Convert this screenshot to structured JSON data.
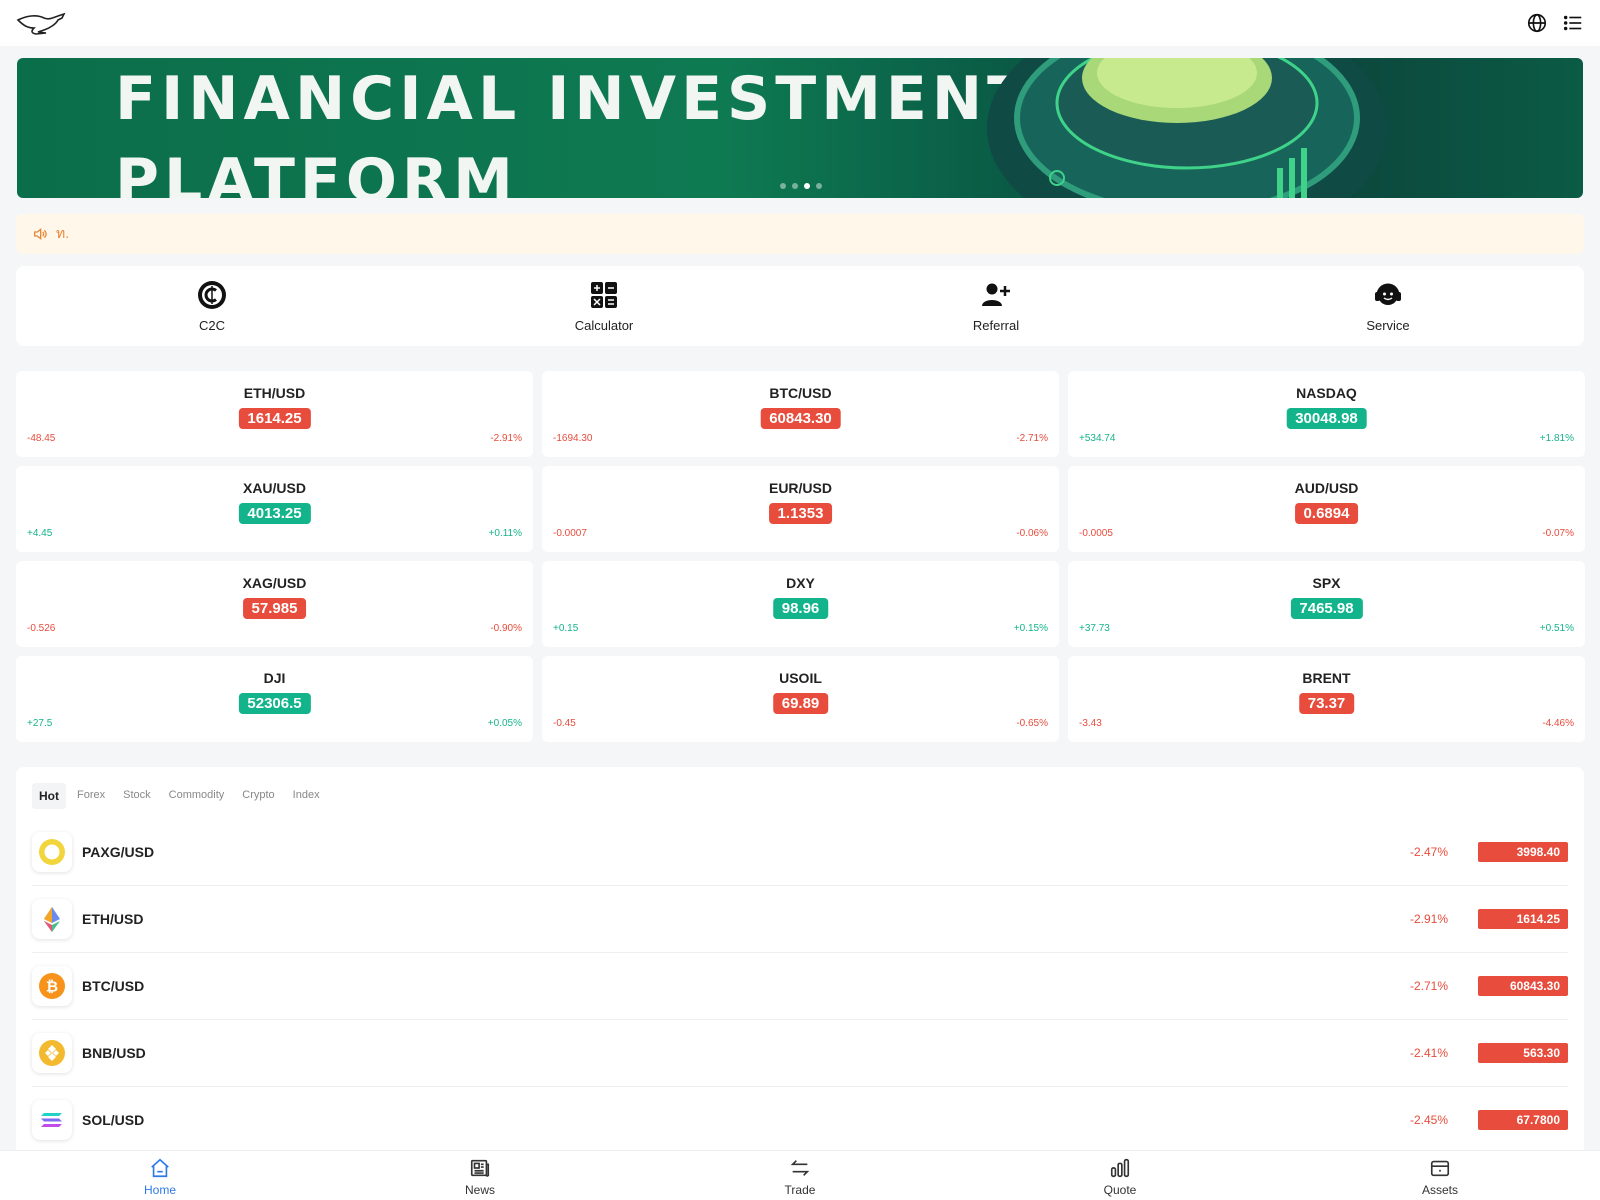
{
  "header": {
    "logo_icon": "kangaroo-logo",
    "language_icon": "globe-icon",
    "menu_icon": "list-menu-icon"
  },
  "banner": {
    "line1": "FINANCIAL INVESTMENT",
    "line2": "PLATFORM",
    "slide_count": 4,
    "active_slide": 3
  },
  "notice": {
    "icon": "speaker-icon",
    "text": "ท."
  },
  "shortcuts": [
    {
      "label": "C2C",
      "icon": "c2c-coin-icon"
    },
    {
      "label": "Calculator",
      "icon": "calculator-icon"
    },
    {
      "label": "Referral",
      "icon": "add-user-icon"
    },
    {
      "label": "Service",
      "icon": "headset-icon"
    }
  ],
  "quotes": [
    {
      "name": "ETH/USD",
      "price": "1614.25",
      "change": "-48.45",
      "pct": "-2.91%",
      "dir": "down"
    },
    {
      "name": "BTC/USD",
      "price": "60843.30",
      "change": "-1694.30",
      "pct": "-2.71%",
      "dir": "down"
    },
    {
      "name": "NASDAQ",
      "price": "30048.98",
      "change": "+534.74",
      "pct": "+1.81%",
      "dir": "up"
    },
    {
      "name": "XAU/USD",
      "price": "4013.25",
      "change": "+4.45",
      "pct": "+0.11%",
      "dir": "up"
    },
    {
      "name": "EUR/USD",
      "price": "1.1353",
      "change": "-0.0007",
      "pct": "-0.06%",
      "dir": "down"
    },
    {
      "name": "AUD/USD",
      "price": "0.6894",
      "change": "-0.0005",
      "pct": "-0.07%",
      "dir": "down"
    },
    {
      "name": "XAG/USD",
      "price": "57.985",
      "change": "-0.526",
      "pct": "-0.90%",
      "dir": "down"
    },
    {
      "name": "DXY",
      "price": "98.96",
      "change": "+0.15",
      "pct": "+0.15%",
      "dir": "up"
    },
    {
      "name": "SPX",
      "price": "7465.98",
      "change": "+37.73",
      "pct": "+0.51%",
      "dir": "up"
    },
    {
      "name": "DJI",
      "price": "52306.5",
      "change": "+27.5",
      "pct": "+0.05%",
      "dir": "up"
    },
    {
      "name": "USOIL",
      "price": "69.89",
      "change": "-0.45",
      "pct": "-0.65%",
      "dir": "down"
    },
    {
      "name": "BRENT",
      "price": "73.37",
      "change": "-3.43",
      "pct": "-4.46%",
      "dir": "down"
    }
  ],
  "market": {
    "tabs": [
      "Hot",
      "Forex",
      "Stock",
      "Commodity",
      "Crypto",
      "Index"
    ],
    "active_tab": "Hot",
    "rows": [
      {
        "name": "PAXG/USD",
        "pct": "-2.47%",
        "price": "3998.40",
        "icon": "paxg-icon"
      },
      {
        "name": "ETH/USD",
        "pct": "-2.91%",
        "price": "1614.25",
        "icon": "ethereum-icon"
      },
      {
        "name": "BTC/USD",
        "pct": "-2.71%",
        "price": "60843.30",
        "icon": "bitcoin-icon"
      },
      {
        "name": "BNB/USD",
        "pct": "-2.41%",
        "price": "563.30",
        "icon": "bnb-icon"
      },
      {
        "name": "SOL/USD",
        "pct": "-2.45%",
        "price": "67.7800",
        "icon": "solana-icon"
      }
    ]
  },
  "bottom_nav": [
    {
      "label": "Home",
      "icon": "home-icon",
      "active": true
    },
    {
      "label": "News",
      "icon": "newspaper-icon",
      "active": false
    },
    {
      "label": "Trade",
      "icon": "swap-arrows-icon",
      "active": false
    },
    {
      "label": "Quote",
      "icon": "bar-chart-icon",
      "active": false
    },
    {
      "label": "Assets",
      "icon": "wallet-icon",
      "active": false
    }
  ],
  "colors": {
    "down": "#e74c3c",
    "up": "#13b48c",
    "accent": "#2f7be6",
    "notice_text": "#e8873a",
    "notice_bg": "#fff8ea"
  }
}
